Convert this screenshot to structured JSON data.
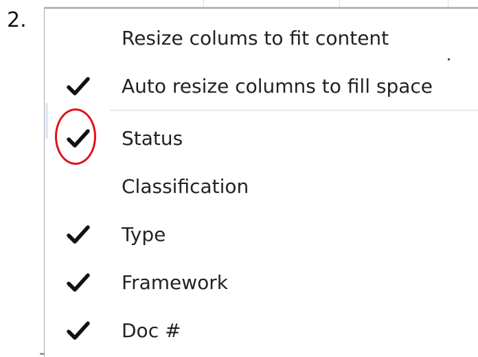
{
  "step_label": "2.",
  "menu": {
    "items": [
      {
        "label": "Resize colums to fit content",
        "checked": false
      },
      {
        "label": "Auto resize columns to fill space",
        "checked": true
      },
      {
        "label": "Status",
        "checked": true
      },
      {
        "label": "Classification",
        "checked": false
      },
      {
        "label": "Type",
        "checked": true
      },
      {
        "label": "Framework",
        "checked": true
      },
      {
        "label": "Doc #",
        "checked": true
      }
    ]
  },
  "annotation": {
    "highlight_color": "#e0101a"
  },
  "icons": {
    "check": "checkmark-icon"
  }
}
